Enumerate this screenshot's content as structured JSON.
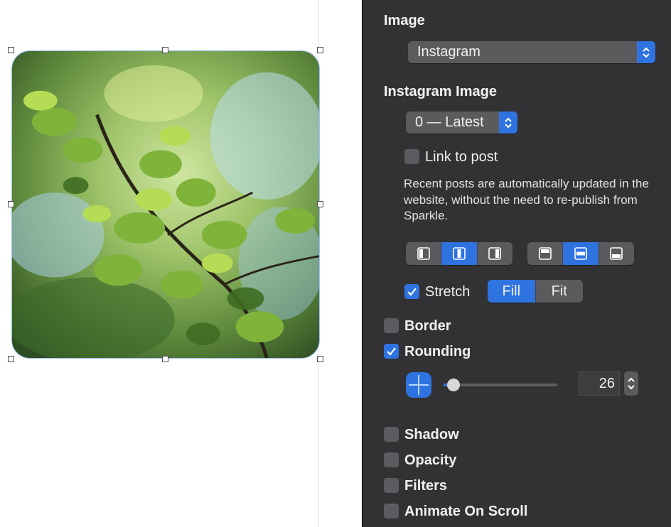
{
  "inspector": {
    "image_heading": "Image",
    "image_source_select": "Instagram",
    "instagram_heading": "Instagram Image",
    "post_select": "0 — Latest",
    "link_to_post_label": "Link to post",
    "link_to_post_checked": false,
    "description": "Recent posts are automatically updated in the website, without the need to re-publish from Sparkle.",
    "stretch_label": "Stretch",
    "stretch_checked": true,
    "fill_label": "Fill",
    "fit_label": "Fit",
    "fill_selected": true,
    "border_label": "Border",
    "rounding_label": "Rounding",
    "rounding_value": "26",
    "shadow_label": "Shadow",
    "opacity_label": "Opacity",
    "filters_label": "Filters",
    "animate_label": "Animate On Scroll"
  },
  "colors": {
    "accent": "#2f73e0",
    "panel_bg": "#323235"
  },
  "icons": [
    "updown-chevron-icon",
    "checkmark-icon",
    "align-left-icon",
    "align-center-icon",
    "align-right-icon",
    "align-top-icon",
    "align-middle-icon",
    "align-bottom-icon",
    "corner-radius-icon"
  ]
}
